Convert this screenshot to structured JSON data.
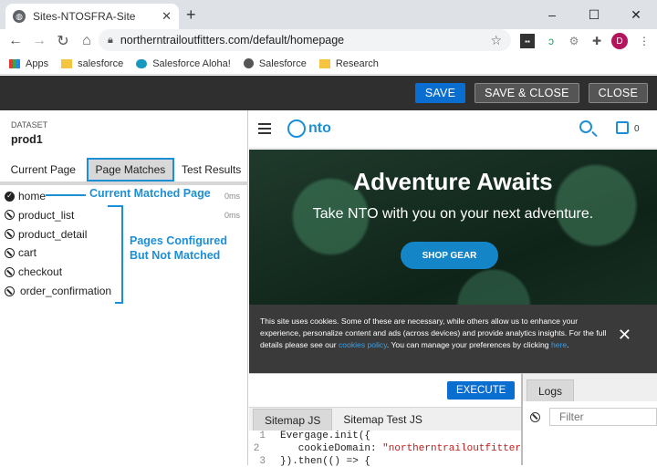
{
  "browser": {
    "tab_title": "Sites-NTOSFRA-Site",
    "url": "northerntrailoutfitters.com/default/homepage",
    "profile_initial": "D",
    "bookmarks": [
      "Apps",
      "salesforce",
      "Salesforce Aloha!",
      "Salesforce",
      "Research"
    ]
  },
  "header": {
    "save_label": "SAVE",
    "save_close_label": "SAVE & CLOSE",
    "close_label": "CLOSE"
  },
  "left": {
    "dataset_label": "DATASET",
    "dataset_value": "prod1",
    "tabs": [
      "Current Page",
      "Page Matches",
      "Test Results"
    ],
    "active_tab": "Page Matches",
    "pages": [
      {
        "name": "home",
        "matched": true,
        "time": "0ms"
      },
      {
        "name": "product_list",
        "matched": false,
        "time": "0ms"
      },
      {
        "name": "product_detail",
        "matched": false,
        "time": ""
      },
      {
        "name": "cart",
        "matched": false,
        "time": ""
      },
      {
        "name": "checkout",
        "matched": false,
        "time": ""
      },
      {
        "name": "order_confirmation",
        "matched": false,
        "time": ""
      }
    ],
    "annotation_matched": "Current Matched Page",
    "annotation_unmatched_1": "Pages Configured",
    "annotation_unmatched_2": "But Not Matched"
  },
  "site": {
    "logo_text": "nto",
    "cart_count": "0",
    "hero_title": "Adventure Awaits",
    "hero_subtitle": "Take NTO with you on your next adventure.",
    "shop_button": "SHOP GEAR",
    "cookie_text_1": "This site uses cookies. Some of these are necessary, while others allow us to enhance your experience, personalize content and ads (across devices) and provide analytics insights. For the full details please see our ",
    "cookie_link_1": "cookies policy",
    "cookie_text_2": ". You can manage your preferences by clicking ",
    "cookie_link_2": "here",
    "cookie_text_3": "."
  },
  "code_panel": {
    "execute_label": "EXECUTE",
    "tabs": [
      "Sitemap JS",
      "Sitemap Test JS"
    ],
    "active_tab": "Sitemap JS",
    "lines": [
      {
        "n": "1",
        "text": "Evergage.init({",
        "str": ""
      },
      {
        "n": "2",
        "text": "    cookieDomain: ",
        "str": "\"northerntrailoutfitter"
      },
      {
        "n": "3",
        "text": "}).then(() => {",
        "str": ""
      }
    ]
  },
  "logs": {
    "tab_label": "Logs",
    "filter_placeholder": "Filter"
  },
  "colors": {
    "accent": "#1d8fd6",
    "primary_button": "#0a6ed1",
    "header_bg": "#2f2f2f"
  }
}
